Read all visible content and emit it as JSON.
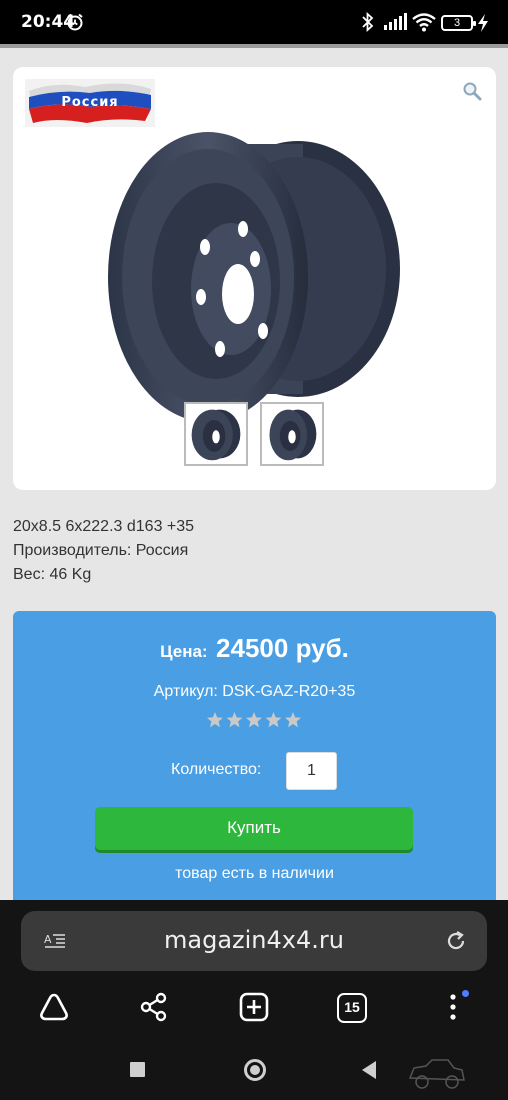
{
  "status_bar": {
    "time": "20:44",
    "battery_level": "3",
    "icons": [
      "alarm-icon",
      "bluetooth-icon",
      "signal-icon",
      "wifi-icon",
      "battery-icon",
      "charging-icon"
    ]
  },
  "product": {
    "flag_text": "Россия",
    "specs": {
      "title": "20x8.5 6x222.3 d163 +35",
      "manufacturer": "Производитель: Россия",
      "weight": "Вес: 46 Kg"
    }
  },
  "buy_panel": {
    "price_label": "Цена:",
    "price_value": "24500 руб.",
    "sku": "Артикул: DSK-GAZ-R20+35",
    "rating_stars": 5,
    "quantity_label": "Количество:",
    "quantity_value": "1",
    "buy_label": "Купить",
    "stock_text": "товар есть в наличии"
  },
  "browser": {
    "url": "magazin4x4.ru",
    "tab_count": "15",
    "toolbar_icons": [
      "home-icon",
      "share-icon",
      "new-tab-icon",
      "tabs-icon",
      "menu-icon"
    ]
  },
  "colors": {
    "panel_blue": "#4a9ee3",
    "buy_green": "#2db83d",
    "browser_dark": "#141414",
    "menu_dot": "#4f7dff"
  }
}
